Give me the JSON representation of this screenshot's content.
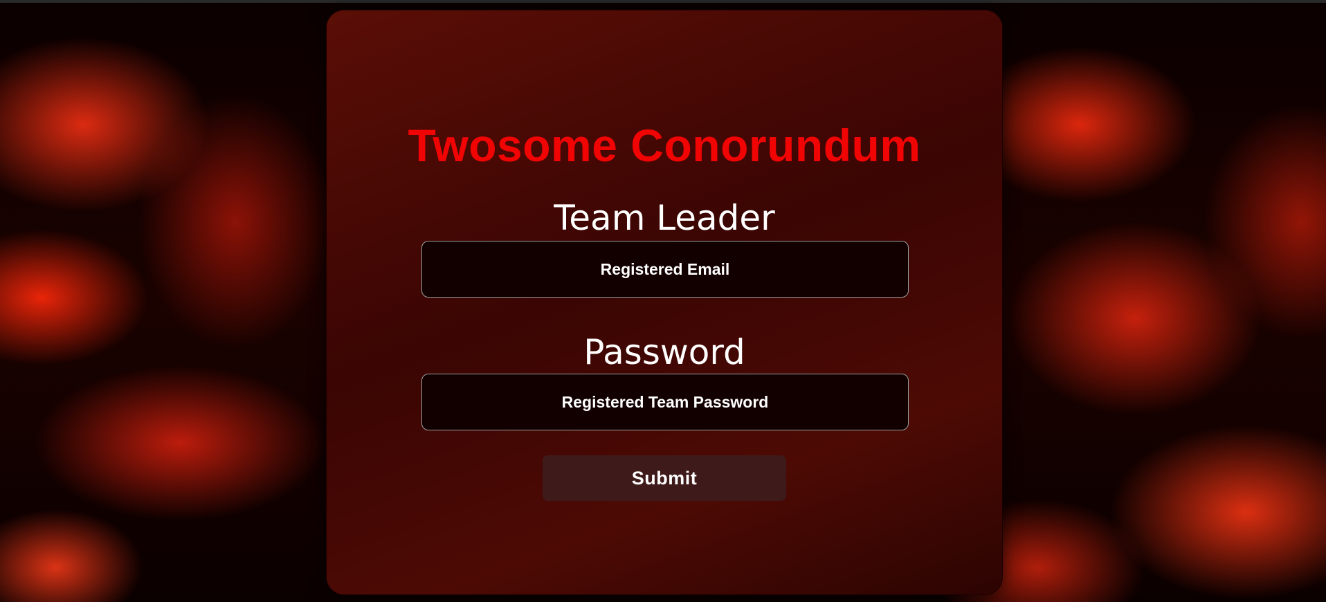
{
  "form": {
    "title": "Twosome Conorundum",
    "leader_label": "Team Leader",
    "email_placeholder": "Registered Email",
    "email_value": "",
    "password_label": "Password",
    "password_placeholder": "Registered Team Password",
    "password_value": "",
    "submit_label": "Submit"
  },
  "theme": {
    "title_color": "#f10404",
    "card_color": "#4a0804",
    "field_bg": "#120000",
    "button_bg": "#3f1a1a"
  }
}
